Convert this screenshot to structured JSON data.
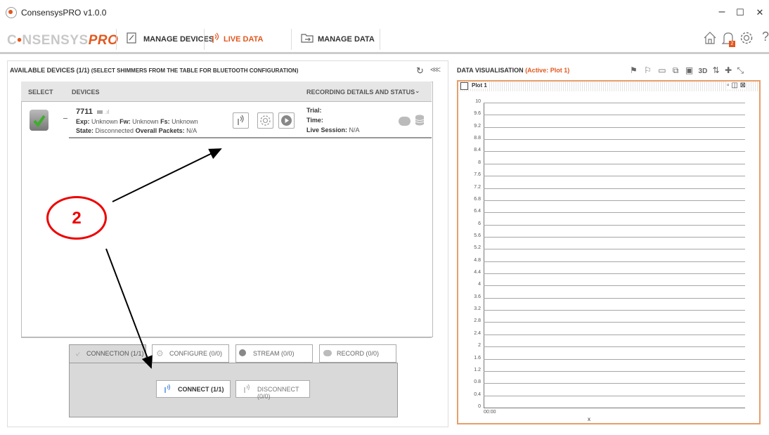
{
  "window": {
    "title": "ConsensysPRO v1.0.0",
    "min": "–",
    "max": "☐",
    "close": "✕"
  },
  "logo": {
    "c": "C",
    "dot": "•",
    "nsensys": "NSENSYS",
    "pro": "PRO"
  },
  "nav": {
    "manage_devices": "MANAGE DEVICES",
    "live_data": "LIVE DATA",
    "manage_data": "MANAGE DATA",
    "notification_count": "2",
    "accent_color": "#e2571e"
  },
  "left": {
    "header": "AVAILABLE DEVICES (1/1)",
    "header_sub": "(SELECT SHIMMERS FROM THE TABLE FOR BLUETOOTH CONFIGURATION)",
    "columns": {
      "select": "SELECT",
      "devices": "DEVICES",
      "recording": "RECORDING DETAILS AND STATUS"
    },
    "device": {
      "name": "7711",
      "exp_label": "Exp:",
      "exp": "Unknown",
      "fw_label": "Fw:",
      "fw": "Unknown",
      "fs_label": "Fs:",
      "fs": "Unknown",
      "state_label": "State:",
      "state": "Disconnected",
      "packets_label": "Overall Packets:",
      "packets": "N/A",
      "trial_label": "Trial:",
      "time_label": "Time:",
      "live_label": "Live Session:",
      "live": "N/A"
    },
    "tabs": {
      "connection": "CONNECTION (1/1)",
      "configure": "CONFIGURE (0/0)",
      "stream": "STREAM (0/0)",
      "record": "RECORD (0/0)"
    },
    "buttons": {
      "connect": "CONNECT (1/1)",
      "disconnect": "DISCONNECT (0/0)"
    }
  },
  "right": {
    "header": "DATA VISUALISATION",
    "active": "(Active: Plot 1)",
    "plot_title": "Plot 1",
    "toolbar_3d": "3D",
    "y_ticks": [
      "10",
      "9.6",
      "9.2",
      "8.8",
      "8.4",
      "8",
      "7.6",
      "7.2",
      "6.8",
      "6.4",
      "6",
      "5.6",
      "5.2",
      "4.8",
      "4.4",
      "4",
      "3.6",
      "3.2",
      "2.8",
      "2.4",
      "2",
      "1.6",
      "1.2",
      "0.8",
      "0.4",
      "0"
    ],
    "x_tick": "00:00",
    "x_label": "x"
  },
  "annotation": {
    "number": "2"
  }
}
